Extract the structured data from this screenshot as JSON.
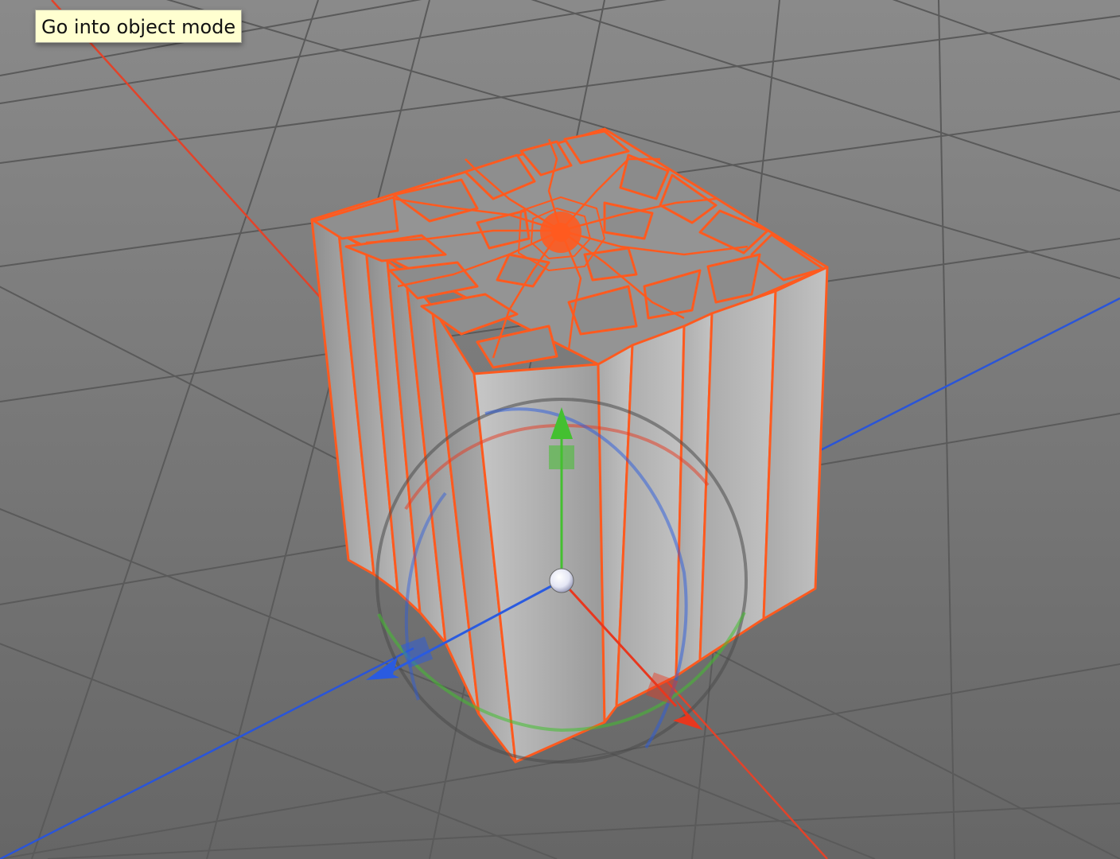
{
  "app": {
    "tooltip_text": "Go into object mode"
  },
  "viewport": {
    "view": "perspective",
    "background_top": "#8a8a8a",
    "background_bottom": "#666666",
    "grid_color": "#5a5a5a",
    "grid_visible": true
  },
  "axes": {
    "x_axis_color": "#e2432a",
    "z_axis_color": "#2a55d8"
  },
  "selection": {
    "highlight_color": "#ff5a1f",
    "object": "fractured-cube",
    "selected": true
  },
  "gizmo": {
    "mode": "move-rotate",
    "x_color": "#e8371e",
    "y_color": "#44c030",
    "z_color": "#2a5be0",
    "center_color": "#ffffff",
    "icons": [
      "x-arrow-icon",
      "y-arrow-icon",
      "z-arrow-icon",
      "center-handle-icon"
    ]
  }
}
